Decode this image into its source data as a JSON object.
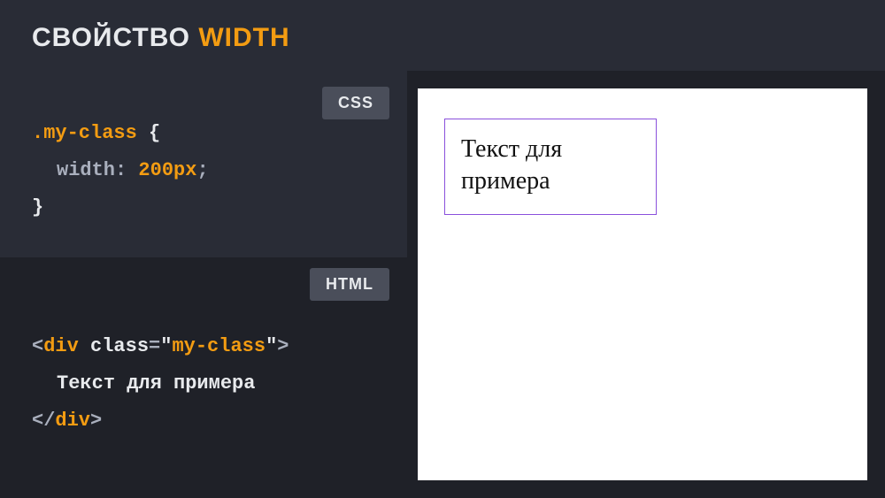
{
  "header": {
    "title_part1": "СВОЙСТВО ",
    "title_part2": "WIDTH"
  },
  "css_block": {
    "label": "CSS",
    "selector": ".my-class",
    "brace_open": " {",
    "property": "width",
    "colon": ": ",
    "value": "200px",
    "semicolon": ";",
    "brace_close": "}"
  },
  "html_block": {
    "label": "HTML",
    "open_angle": "<",
    "tag": "div",
    "attr_name": "class",
    "eq": "=",
    "quote": "\"",
    "attr_value": "my-class",
    "close_angle": ">",
    "inner_text": "Текст для примера",
    "close_open": "</",
    "close_tag": "div",
    "close_close": ">"
  },
  "preview": {
    "example_text": "Текст для примера"
  }
}
